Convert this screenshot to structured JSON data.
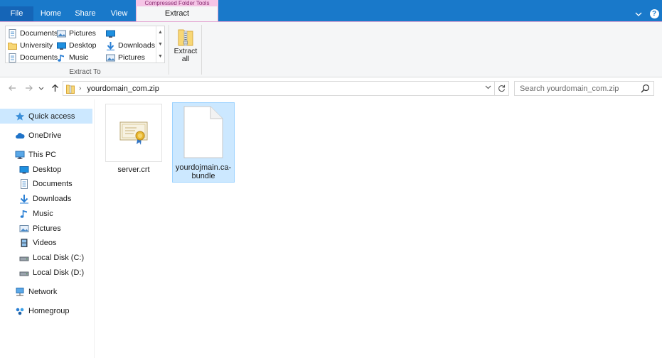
{
  "ribbon_tabs": {
    "context_label": "Compressed Folder Tools",
    "file": "File",
    "home": "Home",
    "share": "Share",
    "view": "View",
    "extract": "Extract"
  },
  "extract_to": {
    "group_label": "Extract To",
    "items": [
      {
        "label": "Documents",
        "icon": "documents-icon"
      },
      {
        "label": "Pictures",
        "icon": "pictures-icon"
      },
      {
        "label": "",
        "icon": "desktop-icon"
      },
      {
        "label": "University",
        "icon": "folder-icon"
      },
      {
        "label": "Desktop",
        "icon": "desktop-icon"
      },
      {
        "label": "Downloads",
        "icon": "downloads-icon"
      },
      {
        "label": "Documents",
        "icon": "documents-icon"
      },
      {
        "label": "Music",
        "icon": "music-icon"
      },
      {
        "label": "Pictures",
        "icon": "pictures-icon"
      }
    ]
  },
  "extract_all": {
    "line1": "Extract",
    "line2": "all"
  },
  "address": {
    "path": "yourdomain_com.zip",
    "search_placeholder": "Search yourdomain_com.zip"
  },
  "nav_pane": {
    "items": [
      {
        "label": "Quick access",
        "icon": "star-icon",
        "level": 0,
        "selected": true
      },
      {
        "label": "OneDrive",
        "icon": "cloud-icon",
        "level": 0
      },
      {
        "label": "This PC",
        "icon": "computer-icon",
        "level": 0
      },
      {
        "label": "Desktop",
        "icon": "desktop-icon",
        "level": 1
      },
      {
        "label": "Documents",
        "icon": "documents-icon",
        "level": 1
      },
      {
        "label": "Downloads",
        "icon": "downloads-icon",
        "level": 1
      },
      {
        "label": "Music",
        "icon": "music-icon",
        "level": 1
      },
      {
        "label": "Pictures",
        "icon": "pictures-icon",
        "level": 1
      },
      {
        "label": "Videos",
        "icon": "videos-icon",
        "level": 1
      },
      {
        "label": "Local Disk (C:)",
        "icon": "drive-icon",
        "level": 1
      },
      {
        "label": "Local Disk (D:)",
        "icon": "drive-icon",
        "level": 1
      },
      {
        "label": "Network",
        "icon": "network-icon",
        "level": 0
      },
      {
        "label": "Homegroup",
        "icon": "homegroup-icon",
        "level": 0
      }
    ]
  },
  "files": [
    {
      "name": "server.crt",
      "icon": "certificate-icon",
      "selected": false
    },
    {
      "name": "yourdojmain.ca-bundle",
      "icon": "generic-file-icon",
      "selected": true
    }
  ],
  "colors": {
    "titlebar": "#1979ca",
    "file_tab": "#1565b7",
    "context_tab": "#f5c5e6",
    "selection": "#cce8ff"
  }
}
